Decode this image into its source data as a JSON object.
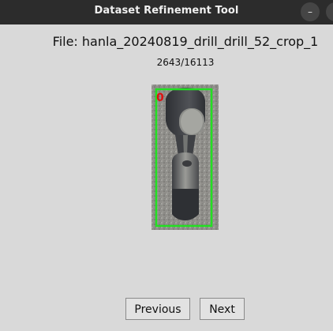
{
  "window": {
    "title": "Dataset Refinement Tool",
    "minimize_glyph": "–",
    "second_control_glyph": ""
  },
  "file": {
    "label": "File: hanla_20240819_drill_drill_52_crop_1"
  },
  "progress": {
    "text": "2643/16113",
    "current": 2643,
    "total": 16113
  },
  "annotation": {
    "class_label": "0",
    "box_color": "#22e022",
    "label_color": "#e01010"
  },
  "buttons": {
    "previous_label": "Previous",
    "next_label": "Next"
  },
  "colors": {
    "titlebar": "#2c2c2c",
    "background": "#d9d9d9"
  }
}
